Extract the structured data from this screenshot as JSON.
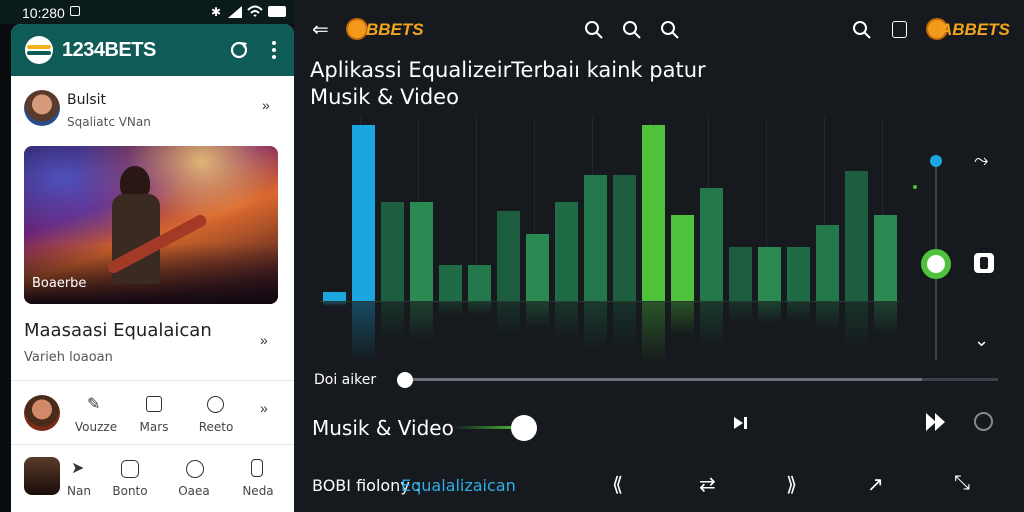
{
  "status": {
    "time": "10:280"
  },
  "left": {
    "brand": "1234BETS",
    "profile": {
      "name": "Bulsit",
      "subtitle": "Sqaliatc VNan"
    },
    "hero_caption": "Boaerbe",
    "section": {
      "title": "Maasaasi Equalaican",
      "subtitle": "Varieh loaoan"
    },
    "actions": [
      {
        "label": "Vouzze"
      },
      {
        "label": "Mars"
      },
      {
        "label": "Reeto"
      }
    ],
    "bottom_nav": [
      {
        "label": "Nan"
      },
      {
        "label": "Bonto"
      },
      {
        "label": "Oaea"
      },
      {
        "label": "Neda"
      }
    ]
  },
  "right": {
    "brand": "BBETS",
    "brand_right": "ABBETS",
    "title_line1": "Aplikassi EqualizeirTerbaiı kaink patur",
    "title_line2": "Musik & Video",
    "eq_levels": [
      0.05,
      0.98,
      0.55,
      0.55,
      0.2,
      0.2,
      0.5,
      0.37,
      0.55,
      0.7,
      0.7,
      0.98,
      0.48,
      0.63,
      0.3,
      0.3,
      0.3,
      0.42,
      0.72,
      0.48
    ],
    "slider_label": "Doi aiker",
    "media_title": "Musik & Video",
    "footer_prefix": "BOBI fiolony :",
    "footer_link": "Equalalizaican",
    "accent": "#4ec23a",
    "blue": "#1aa7e0"
  }
}
